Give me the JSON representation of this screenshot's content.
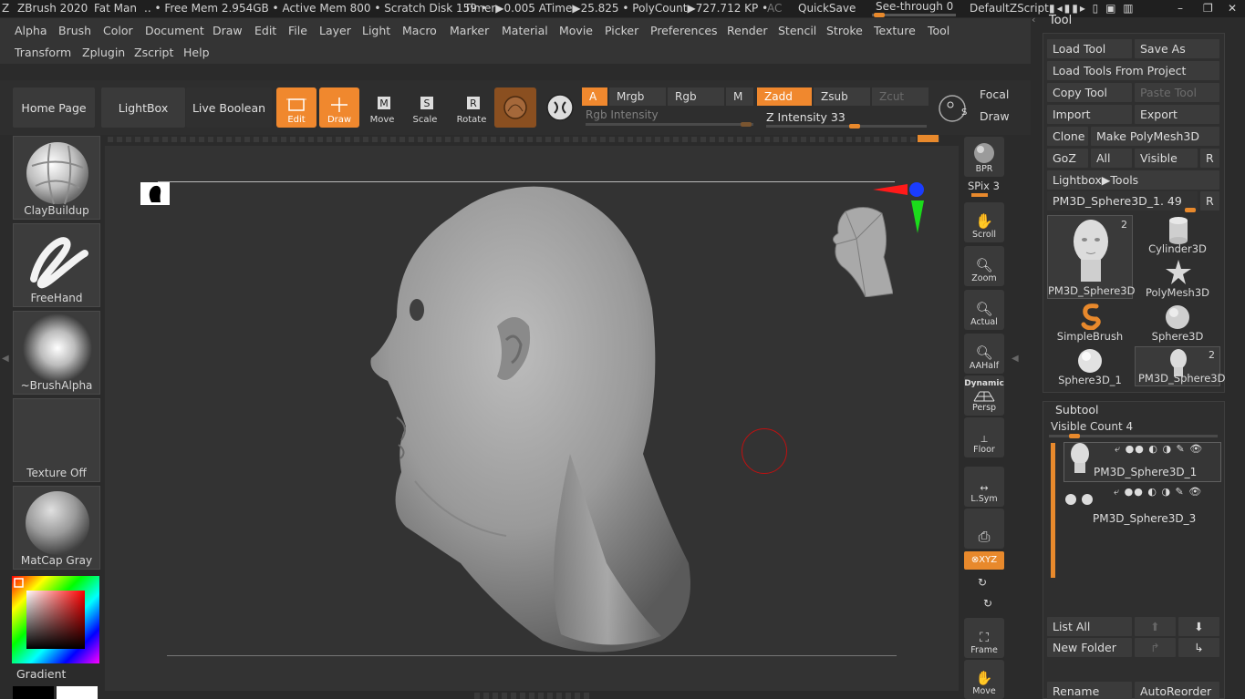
{
  "titlebar": {
    "app": "ZBrush 2020",
    "doc": "Fat Man",
    "stats": ".. • Free Mem 2.954GB • Active Mem 800 • Scratch Disk 159 •",
    "timer": "Timer▶0.005 ATime▶25.825 • PolyCount▶727.712 KP •",
    "ac": "AC",
    "quicksave": "QuickSave",
    "see_through": "See-through  0",
    "script": "DefaultZScript"
  },
  "menu": {
    "row1": [
      "Alpha",
      "Brush",
      "Color",
      "Document",
      "Draw",
      "Edit",
      "File",
      "Layer",
      "Light",
      "Macro",
      "Marker",
      "Material",
      "Movie",
      "Picker",
      "Preferences",
      "Render",
      "Stencil",
      "Stroke",
      "Texture",
      "Tool"
    ],
    "row2": [
      "Transform",
      "Zplugin",
      "Zscript",
      "Help"
    ]
  },
  "shelf": {
    "home_page": "Home Page",
    "lightbox": "LightBox",
    "live_boolean": "Live Boolean",
    "tools": {
      "edit": "Edit",
      "draw": "Draw",
      "move": "Move",
      "scale": "Scale",
      "rotate": "Rotate"
    },
    "modes": {
      "a": "A",
      "mrgb": "Mrgb",
      "rgb": "Rgb",
      "m": "M",
      "zadd": "Zadd",
      "zsub": "Zsub",
      "zcut": "Zcut"
    },
    "rgb_intensity": "Rgb Intensity",
    "z_intensity": "Z Intensity 33",
    "z_intensity_value": 33,
    "focal": "Focal",
    "draw_label": "Draw"
  },
  "left": {
    "brush": "ClayBuildup",
    "stroke": "FreeHand",
    "alpha": "~BrushAlpha",
    "texture": "Texture Off",
    "material": "MatCap Gray",
    "gradient": "Gradient",
    "colors": {
      "main": "#000000",
      "secondary": "#ffffff"
    }
  },
  "right_strip": {
    "bpr": "BPR",
    "spix": "SPix 3",
    "scroll": "Scroll",
    "zoom": "Zoom",
    "actual": "Actual",
    "aahalf": "AAHalf",
    "dynamic": "Dynamic",
    "persp": "Persp",
    "floor": "Floor",
    "lsym": "L.Sym",
    "xyz": "⊗XYZ",
    "frame": "Frame",
    "move": "Move"
  },
  "toolpanel": {
    "title": "Tool",
    "load_tool": "Load Tool",
    "save_as": "Save As",
    "load_from_project": "Load Tools From Project",
    "copy_tool": "Copy Tool",
    "paste_tool": "Paste Tool",
    "import": "Import",
    "export": "Export",
    "clone": "Clone",
    "make_polymesh": "Make PolyMesh3D",
    "goz": "GoZ",
    "all": "All",
    "visible": "Visible",
    "r": "R",
    "lightbox_tools": "Lightbox▶Tools",
    "current_tool": "PM3D_Sphere3D_1. 49",
    "thumbs": [
      {
        "label": "PM3D_Sphere3D",
        "badge": "2"
      },
      {
        "label": "Cylinder3D",
        "badge": ""
      },
      {
        "label": "PolyMesh3D",
        "badge": ""
      },
      {
        "label": "SimpleBrush",
        "badge": ""
      },
      {
        "label": "Sphere3D",
        "badge": ""
      },
      {
        "label": "Sphere3D_1",
        "badge": ""
      },
      {
        "label": "PM3D_Sphere3D",
        "badge": "2"
      }
    ]
  },
  "subtool": {
    "title": "Subtool",
    "visible_count": "Visible Count 4",
    "items": [
      "PM3D_Sphere3D_1",
      "PM3D_Sphere3D_3"
    ],
    "list_all": "List All",
    "new_folder": "New Folder",
    "rename": "Rename",
    "autoreorder": "AutoReorder"
  }
}
